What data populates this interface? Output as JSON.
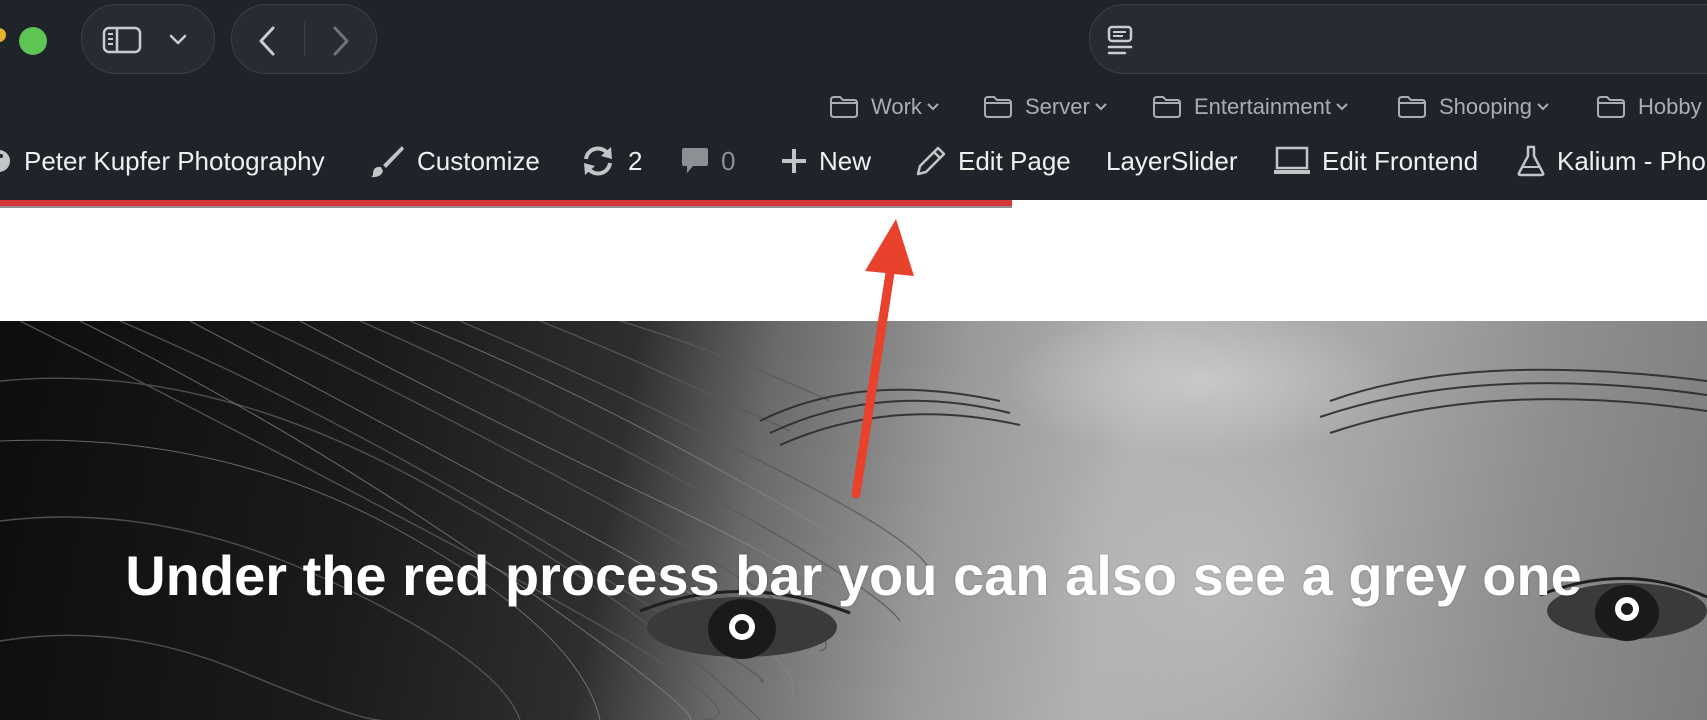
{
  "colors": {
    "chrome_bg": "#1f232a",
    "traffic_green": "#5ec454",
    "progress_red": "#d63638",
    "progress_grey": "#8e8e8e",
    "annotation_arrow": "#e8412c"
  },
  "toolbar": {
    "sidebar_icon": "sidebar-icon",
    "dropdown_icon": "chevron-down-icon",
    "back_icon": "chevron-left-icon",
    "forward_icon": "chevron-right-icon",
    "reader_icon": "reader-icon"
  },
  "bookmarks": [
    {
      "label": "Work"
    },
    {
      "label": "Server"
    },
    {
      "label": "Entertainment"
    },
    {
      "label": "Shooping"
    },
    {
      "label": "Hobby"
    }
  ],
  "admin_bar": {
    "site_name": "Peter Kupfer Photography",
    "customize": "Customize",
    "updates_count": "2",
    "comments_count": "0",
    "new": "New",
    "edit_page": "Edit Page",
    "layerslider": "LayerSlider",
    "edit_frontend": "Edit Frontend",
    "kalium": "Kalium - Pho"
  },
  "progress": {
    "red_fraction": 0.593,
    "grey_fraction": 0.593
  },
  "hero": {
    "caption": "Under the red process bar you can also see a grey one"
  }
}
